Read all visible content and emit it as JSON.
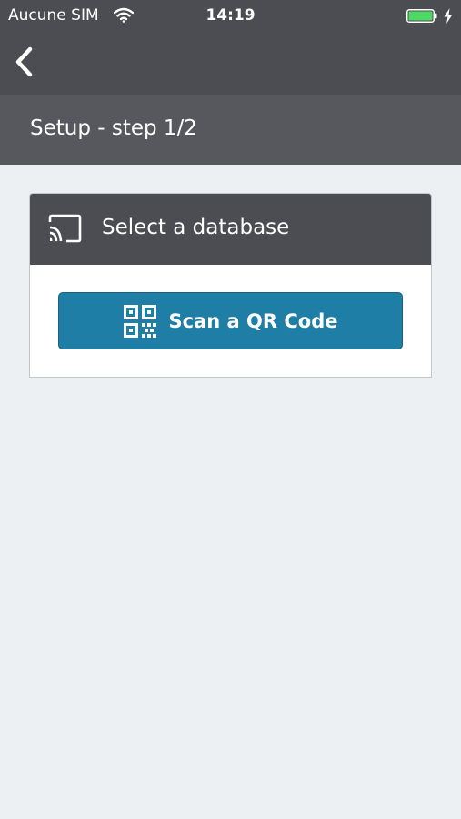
{
  "status_bar": {
    "carrier": "Aucune SIM",
    "time": "14:19",
    "wifi_icon": "wifi-icon",
    "battery_icon": "battery-icon",
    "charging_icon": "bolt-icon",
    "battery_color": "#4cd964"
  },
  "nav": {
    "back_icon": "chevron-left-icon"
  },
  "header": {
    "title": "Setup - step 1/2"
  },
  "card": {
    "icon": "cast-icon",
    "title": "Select a database",
    "button_icon": "qr-code-icon",
    "button_label": "Scan a QR Code"
  },
  "colors": {
    "nav_background": "#4b4d52",
    "subheader_background": "#56585d",
    "page_background": "#ecf0f3",
    "accent": "#1f7ea6"
  }
}
